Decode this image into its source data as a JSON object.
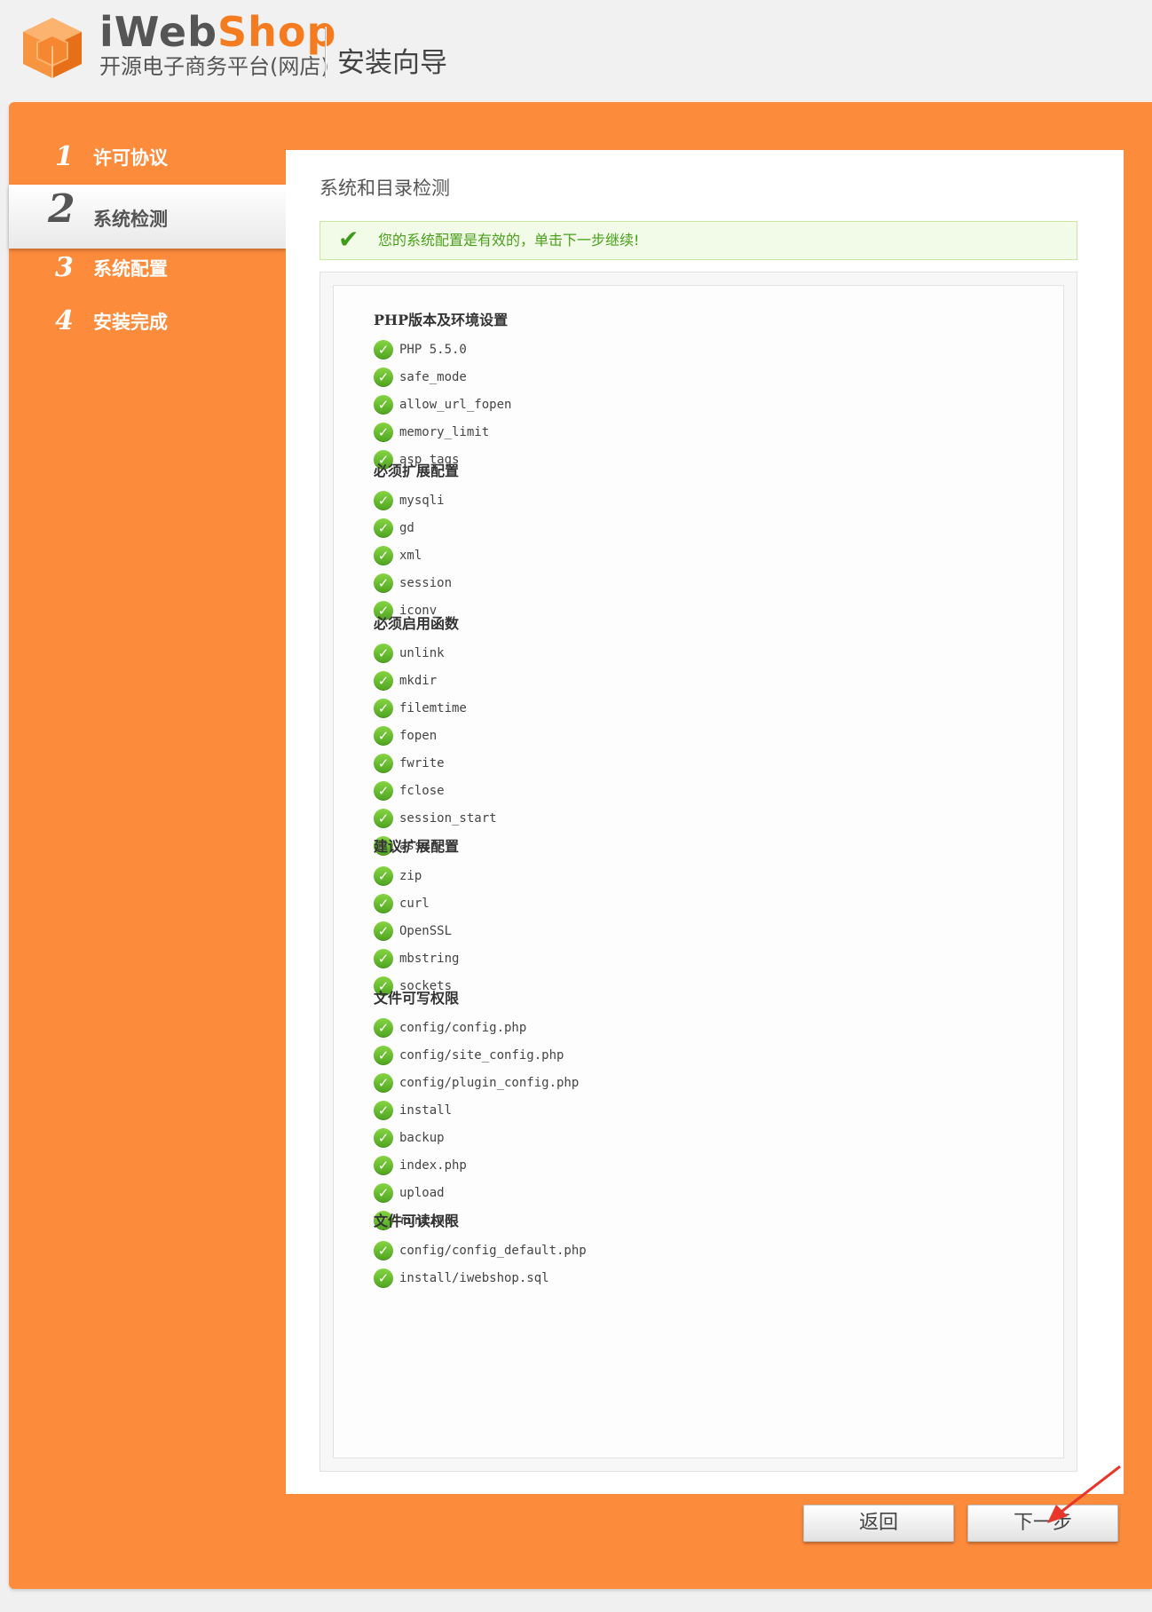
{
  "header": {
    "brand_part1": "iWeb",
    "brand_part2": "Shop",
    "tagline": "开源电子商务平台(网店)",
    "wizard_title": "安装向导"
  },
  "steps": [
    {
      "number": "1",
      "label": "许可协议",
      "active": false
    },
    {
      "number": "2",
      "label": "系统检测",
      "active": true
    },
    {
      "number": "3",
      "label": "系统配置",
      "active": false
    },
    {
      "number": "4",
      "label": "安装完成",
      "active": false
    }
  ],
  "content": {
    "section_title": "系统和目录检测",
    "success_message": "您的系统配置是有效的，单击下一步继续!",
    "groups": [
      {
        "title": "PHP版本及环境设置",
        "items": [
          "PHP 5.5.0",
          "safe_mode",
          "allow_url_fopen",
          "memory_limit",
          "asp_tags"
        ]
      },
      {
        "title": "必须扩展配置",
        "items": [
          "mysqli",
          "gd",
          "xml",
          "session",
          "iconv"
        ]
      },
      {
        "title": "必须启用函数",
        "items": [
          "unlink",
          "mkdir",
          "filemtime",
          "fopen",
          "fwrite",
          "fclose",
          "session_start",
          "assert"
        ]
      },
      {
        "title": "建议扩展配置",
        "items": [
          "zip",
          "curl",
          "OpenSSL",
          "mbstring",
          "sockets"
        ]
      },
      {
        "title": "文件可写权限",
        "items": [
          "config/config.php",
          "config/site_config.php",
          "config/plugin_config.php",
          "install",
          "backup",
          "index.php",
          "upload",
          "runtime"
        ]
      },
      {
        "title": "文件可读权限",
        "items": [
          "config/config_default.php",
          "install/iwebshop.sql"
        ]
      }
    ]
  },
  "buttons": {
    "back_label": "返回",
    "next_label": "下一步"
  },
  "colors": {
    "brand_orange": "#fd8b3c",
    "success_green": "#4ea51f",
    "arrow_red": "#e8362b"
  },
  "icons": {
    "logo": "orange-cube-logo-icon",
    "success": "checkmark-icon",
    "item_status": "green-check-circle-icon"
  }
}
